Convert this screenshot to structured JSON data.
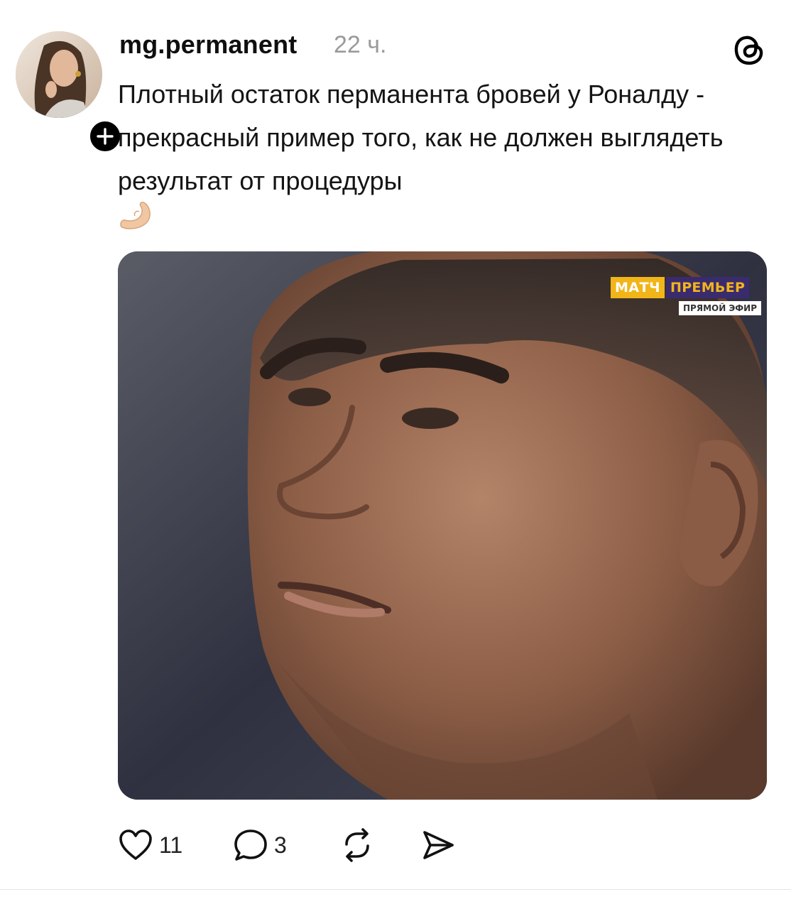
{
  "post": {
    "username": "mg.permanent",
    "timestamp": "22 ч.",
    "text": "Плотный остаток перманента бровей у Роналду - прекрасный пример того, как не должен выглядеть результат от процедуры",
    "emoji": "pinching-hand-emoji"
  },
  "media": {
    "broadcast_logo": {
      "match": "МАТЧ",
      "premier": "ПРЕМЬЕР",
      "live": "ПРЯМОЙ ЭФИР"
    }
  },
  "actions": {
    "like_icon": "heart-icon",
    "like_count": "11",
    "comment_icon": "comment-bubble-icon",
    "comment_count": "3",
    "repost_icon": "repost-icon",
    "share_icon": "send-icon"
  },
  "colors": {
    "accent_black": "#000000",
    "timestamp_gray": "#9a9a9a",
    "logo_yellow": "#f2b519",
    "logo_purple": "#3a2b6e"
  }
}
